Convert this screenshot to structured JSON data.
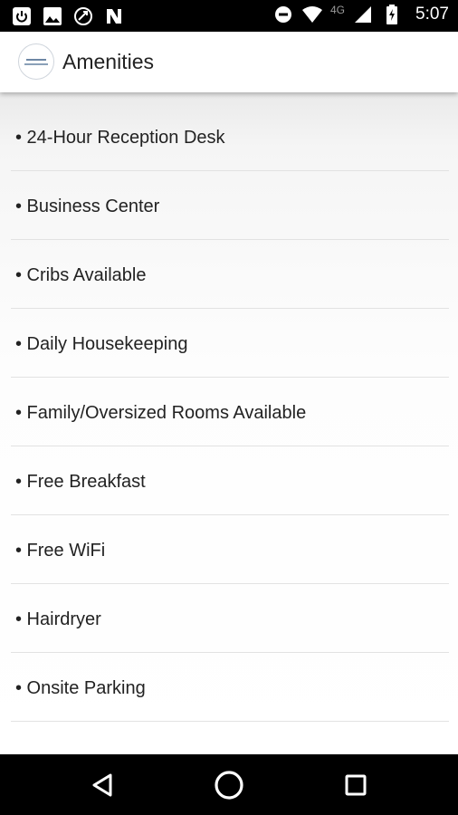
{
  "status_bar": {
    "network": "4G",
    "time": "5:07",
    "left_icons": [
      "power-icon",
      "image-icon",
      "sync-icon",
      "n-icon"
    ],
    "right_icons": [
      "do-not-disturb-icon",
      "wifi-icon",
      "cell-signal-icon",
      "battery-icon"
    ]
  },
  "app_bar": {
    "title": "Amenities",
    "logo_icon": "hotel-logo-icon"
  },
  "amenities": [
    "• 24-Hour Reception Desk",
    "• Business Center",
    "• Cribs Available",
    "• Daily Housekeeping",
    "• Family/Oversized Rooms Available",
    "• Free Breakfast",
    "• Free WiFi",
    "• Hairdryer",
    "• Onsite Parking"
  ],
  "nav_bar": {
    "buttons": [
      "back-icon",
      "home-icon",
      "recents-icon"
    ]
  },
  "colors": {
    "status_bar_bg": "#000000",
    "app_bar_bg": "#ffffff",
    "text": "#222222",
    "divider": "#e2e2e2",
    "nav_bar_bg": "#000000"
  }
}
